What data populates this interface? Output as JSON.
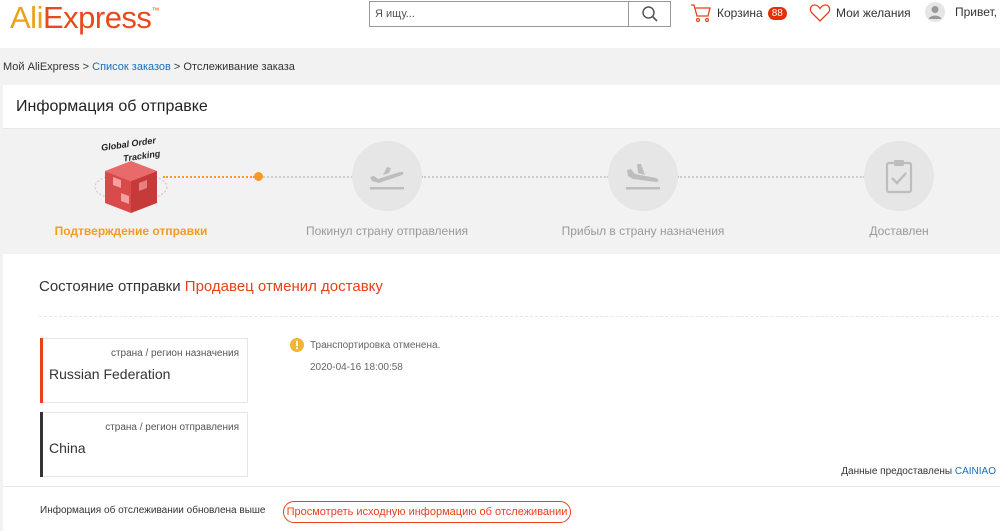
{
  "header": {
    "logo_ali": "Ali",
    "logo_express": "Express",
    "logo_tm": "™",
    "search_placeholder": "Я ищу...",
    "cart_label": "Корзина",
    "cart_count": "88",
    "wishlist_label": "Мои желания",
    "greeting": "Привет,"
  },
  "breadcrumb": {
    "home": "Мой AliExpress",
    "sep1": " > ",
    "orders": "Список заказов",
    "sep2": " > ",
    "current": "Отслеживание заказа"
  },
  "card": {
    "title": "Информация об отправке"
  },
  "steps": {
    "logo_text_1": "Global Order",
    "logo_text_2": "Tracking",
    "items": [
      {
        "label": "Подтверждение отправки",
        "active": true
      },
      {
        "label": "Покинул страну отправления",
        "active": false
      },
      {
        "label": "Прибыл в страну назначения",
        "active": false
      },
      {
        "label": "Доставлен",
        "active": false
      }
    ]
  },
  "status": {
    "label": "Состояние отправки",
    "value": "Продавец отменил доставку"
  },
  "destination": {
    "label": "страна / регион назначения",
    "country": "Russian Federation"
  },
  "origin": {
    "label": "страна / регион отправления",
    "country": "China"
  },
  "event": {
    "text": "Транспортировка отменена.",
    "time": "2020-04-16 18:00:58"
  },
  "provider": {
    "label": "Данные предоставлены",
    "name": "CAINIAO"
  },
  "footer": {
    "note": "Информация об отслеживании обновлена выше",
    "button": "Просмотреть исходную информацию об отслеживании"
  },
  "colors": {
    "accent_orange": "#f59a23",
    "status_red": "#e8401b",
    "link_blue": "#1a6dbb",
    "destination_bar": "#e8401b",
    "origin_bar": "#333333"
  }
}
